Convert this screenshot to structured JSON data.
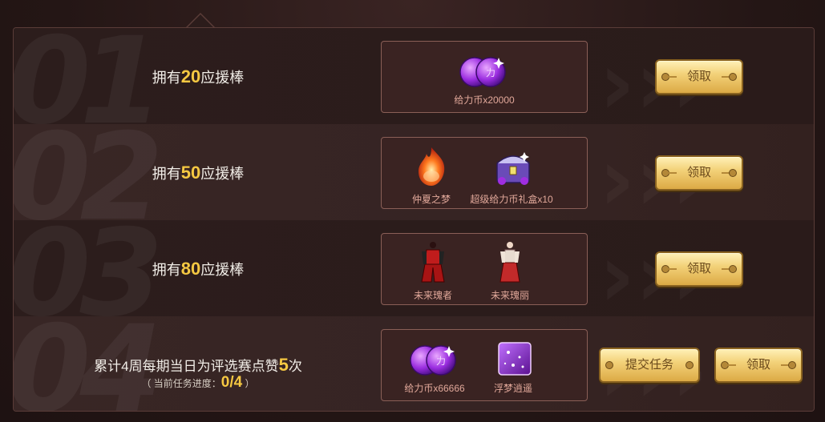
{
  "rows": [
    {
      "number": "01",
      "task": {
        "prefix": "拥有",
        "num": "20",
        "suffix": "应援棒"
      },
      "rewards": [
        {
          "label": "给力币x20000",
          "icon": "coin-icon"
        }
      ],
      "buttons": [
        {
          "label": "领取"
        }
      ]
    },
    {
      "number": "02",
      "task": {
        "prefix": "拥有",
        "num": "50",
        "suffix": "应援棒"
      },
      "rewards": [
        {
          "label": "仲夏之梦",
          "icon": "flame-orb-icon"
        },
        {
          "label": "超级给力币礼盒x10",
          "icon": "treasure-chest-icon"
        }
      ],
      "buttons": [
        {
          "label": "领取"
        }
      ]
    },
    {
      "number": "03",
      "task": {
        "prefix": "拥有",
        "num": "80",
        "suffix": "应援棒"
      },
      "rewards": [
        {
          "label": "未来瑰者",
          "icon": "red-outfit-icon"
        },
        {
          "label": "未来瑰丽",
          "icon": "red-dress-icon"
        }
      ],
      "buttons": [
        {
          "label": "领取"
        }
      ]
    },
    {
      "number": "04",
      "task": {
        "prefix": "累计4周每期当日为评选赛点赞",
        "num": "5",
        "suffix": "次"
      },
      "progress": {
        "prefix": "（ 当前任务进度：",
        "value": "0/4",
        "suffix": " ）"
      },
      "rewards": [
        {
          "label": "给力币x66666",
          "icon": "coin-icon"
        },
        {
          "label": "浮梦逍遥",
          "icon": "purple-sparkle-card-icon"
        }
      ],
      "buttons": [
        {
          "label": "提交任务"
        },
        {
          "label": "领取"
        }
      ]
    }
  ],
  "colors": {
    "accent": "#f5c842",
    "reward_label": "#e1a89a",
    "button": "#f3d27a"
  }
}
